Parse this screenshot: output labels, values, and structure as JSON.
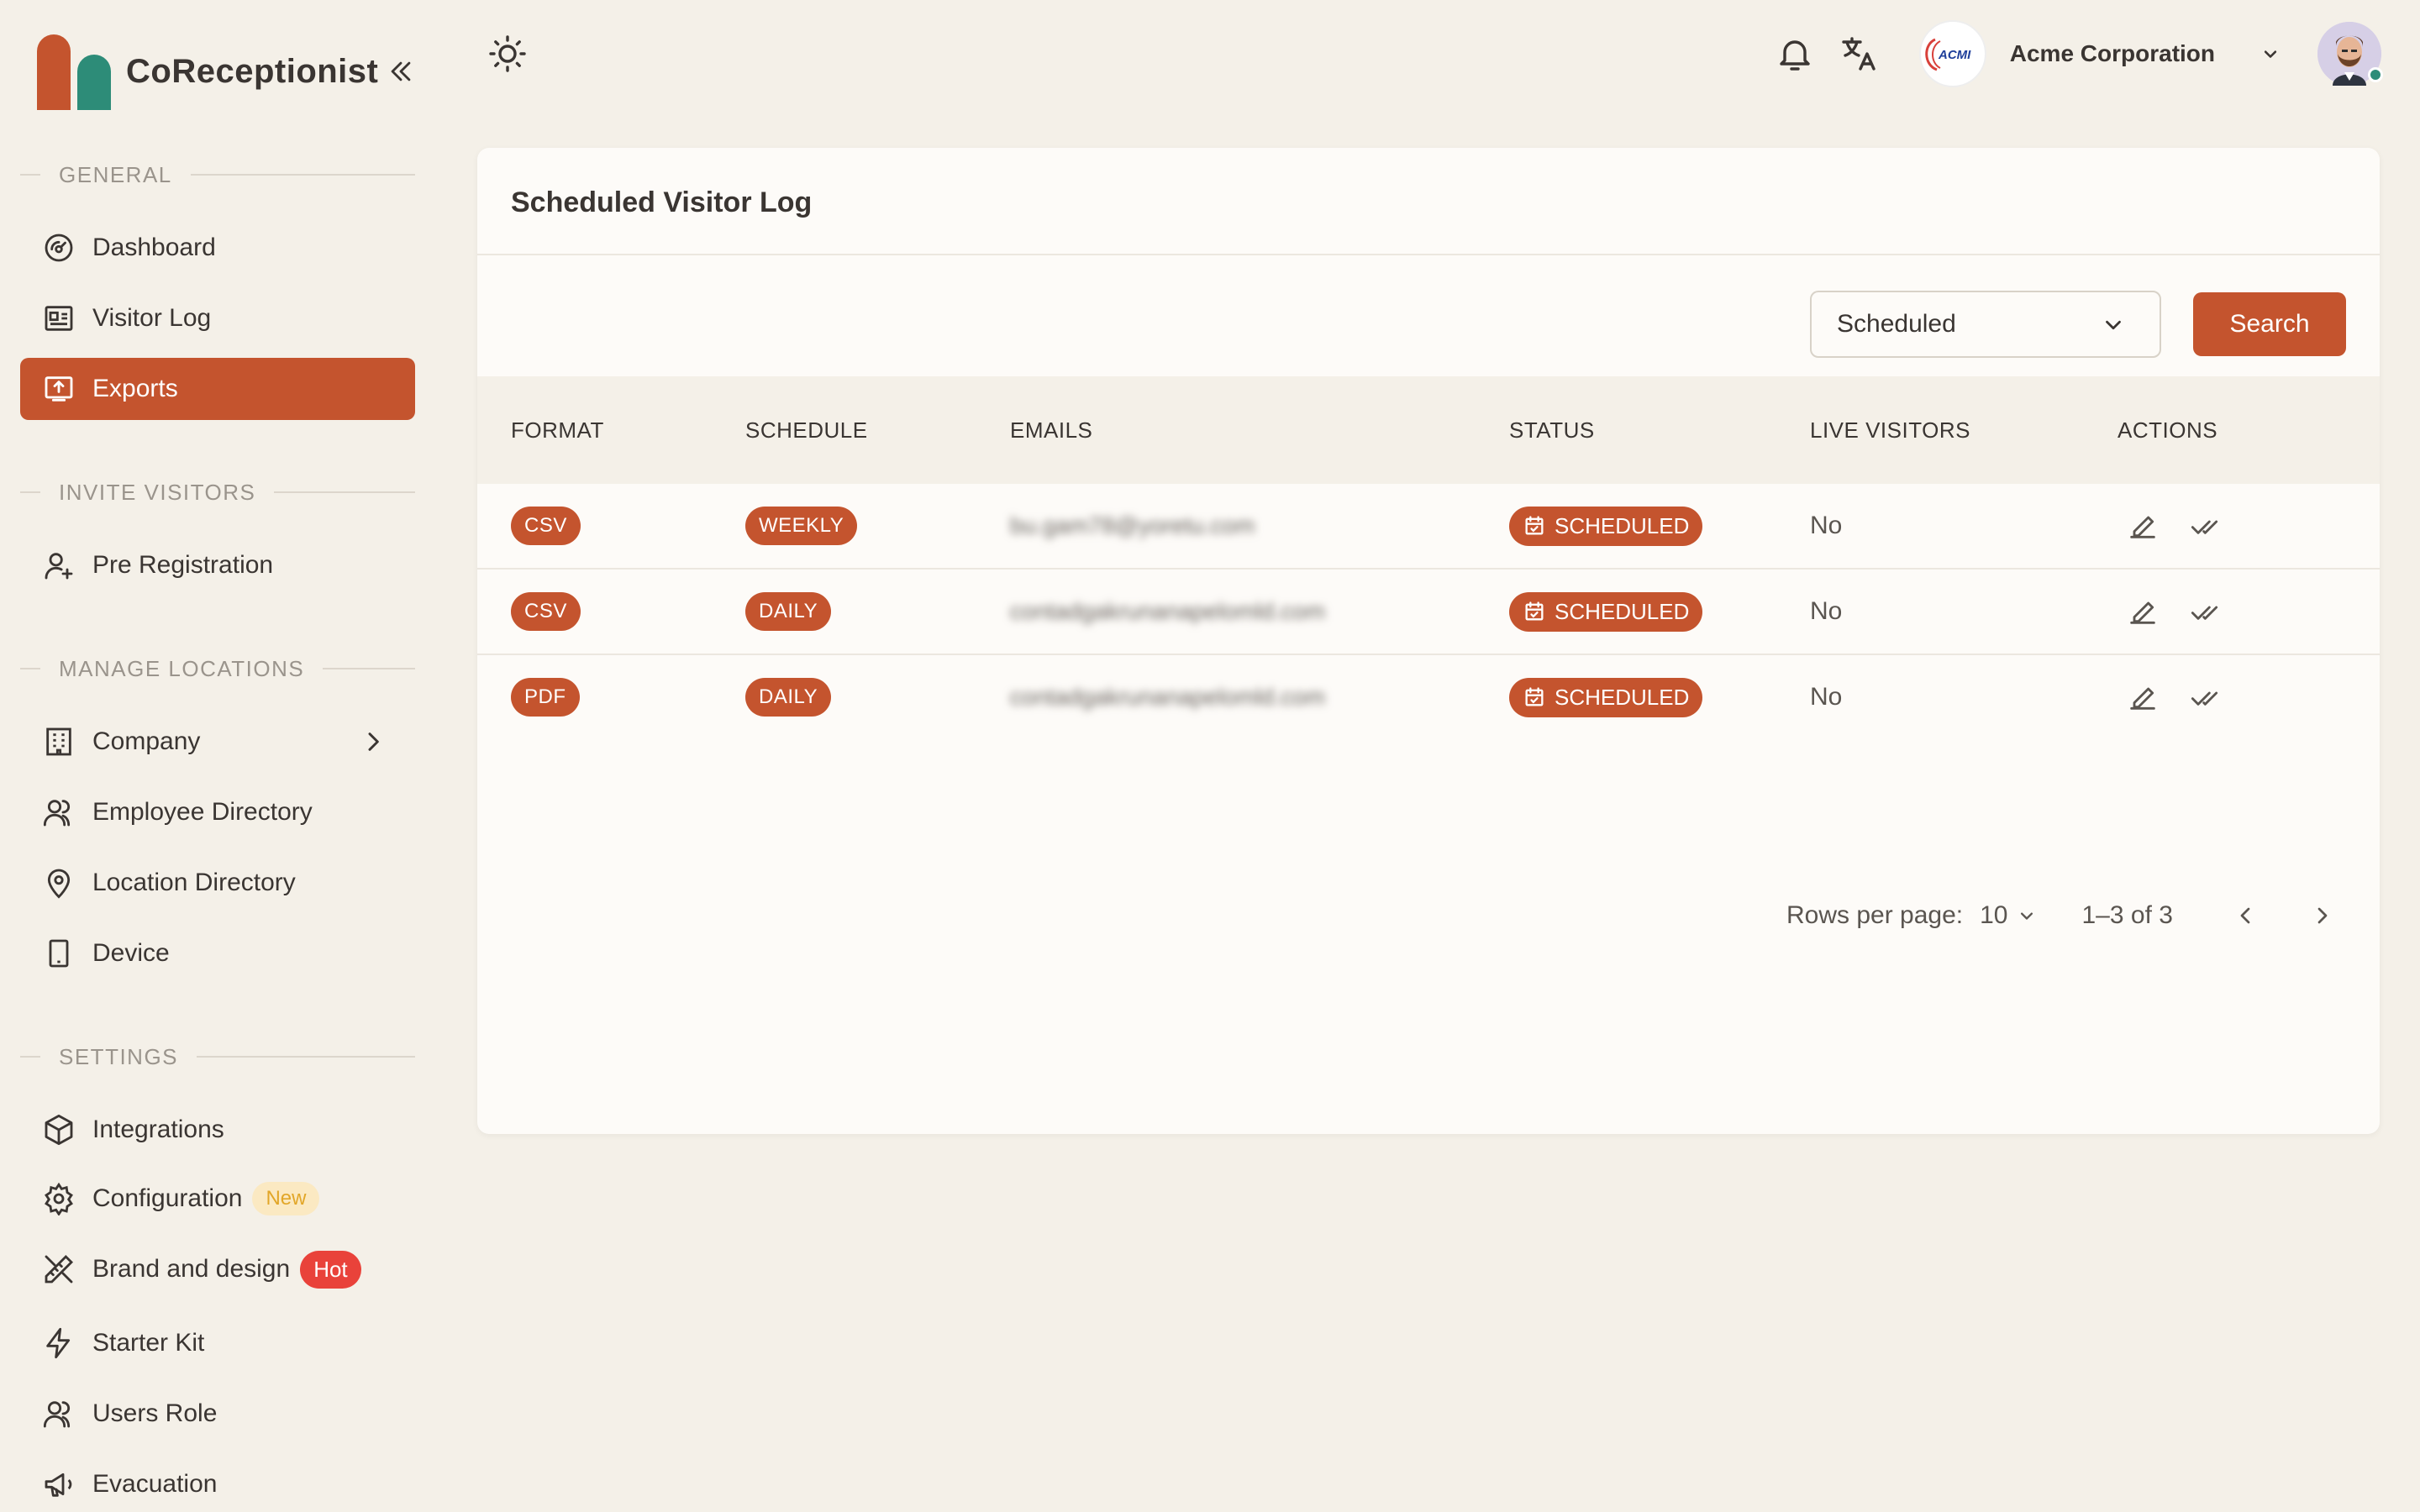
{
  "app": {
    "brand_name": "CoReceptionist",
    "colors": {
      "accent": "#c4542e",
      "secondary": "#2d8c78",
      "background": "#f4f0e8",
      "card": "#fdfbf8"
    }
  },
  "sidebar": {
    "sections": [
      {
        "title": "GENERAL"
      },
      {
        "title": "INVITE VISITORS"
      },
      {
        "title": "MANAGE LOCATIONS"
      },
      {
        "title": "SETTINGS"
      }
    ],
    "items": [
      {
        "label": "Dashboard",
        "icon": "dashboard-gauge-icon"
      },
      {
        "label": "Visitor Log",
        "icon": "visitor-log-icon"
      },
      {
        "label": "Exports",
        "icon": "exports-icon",
        "active": true
      },
      {
        "label": "Pre Registration",
        "icon": "user-add-icon"
      },
      {
        "label": "Company",
        "icon": "building-icon"
      },
      {
        "label": "Employee Directory",
        "icon": "users-icon"
      },
      {
        "label": "Location Directory",
        "icon": "location-pin-icon"
      },
      {
        "label": "Device",
        "icon": "tablet-icon"
      },
      {
        "label": "Integrations",
        "icon": "hexagon-icon"
      },
      {
        "label": "Configuration",
        "icon": "gear-icon",
        "badge": "New"
      },
      {
        "label": "Brand and design",
        "icon": "brush-ruler-icon",
        "badge": "Hot"
      },
      {
        "label": "Starter Kit",
        "icon": "lightning-icon"
      },
      {
        "label": "Users Role",
        "icon": "users-role-icon"
      },
      {
        "label": "Evacuation",
        "icon": "megaphone-icon"
      }
    ]
  },
  "topbar": {
    "org_name": "Acme Corporation",
    "org_logo_text": "ACMI"
  },
  "main": {
    "title": "Scheduled Visitor Log",
    "filter": {
      "selected": "Scheduled"
    },
    "search_label": "Search",
    "columns": [
      "FORMAT",
      "SCHEDULE",
      "EMAILS",
      "STATUS",
      "LIVE VISITORS",
      "ACTIONS"
    ],
    "rows": [
      {
        "format": "CSV",
        "schedule": "WEEKLY",
        "email": "bu.gam78@yoretu.com",
        "status": "SCHEDULED",
        "live": "No"
      },
      {
        "format": "CSV",
        "schedule": "DAILY",
        "email": "contadgakrunanapelomld.com",
        "status": "SCHEDULED",
        "live": "No"
      },
      {
        "format": "PDF",
        "schedule": "DAILY",
        "email": "contadgakrunanapelomld.com",
        "status": "SCHEDULED",
        "live": "No"
      }
    ],
    "pagination": {
      "rows_per_page_label": "Rows per page:",
      "rows_per_page": "10",
      "range": "1–3 of 3"
    }
  }
}
